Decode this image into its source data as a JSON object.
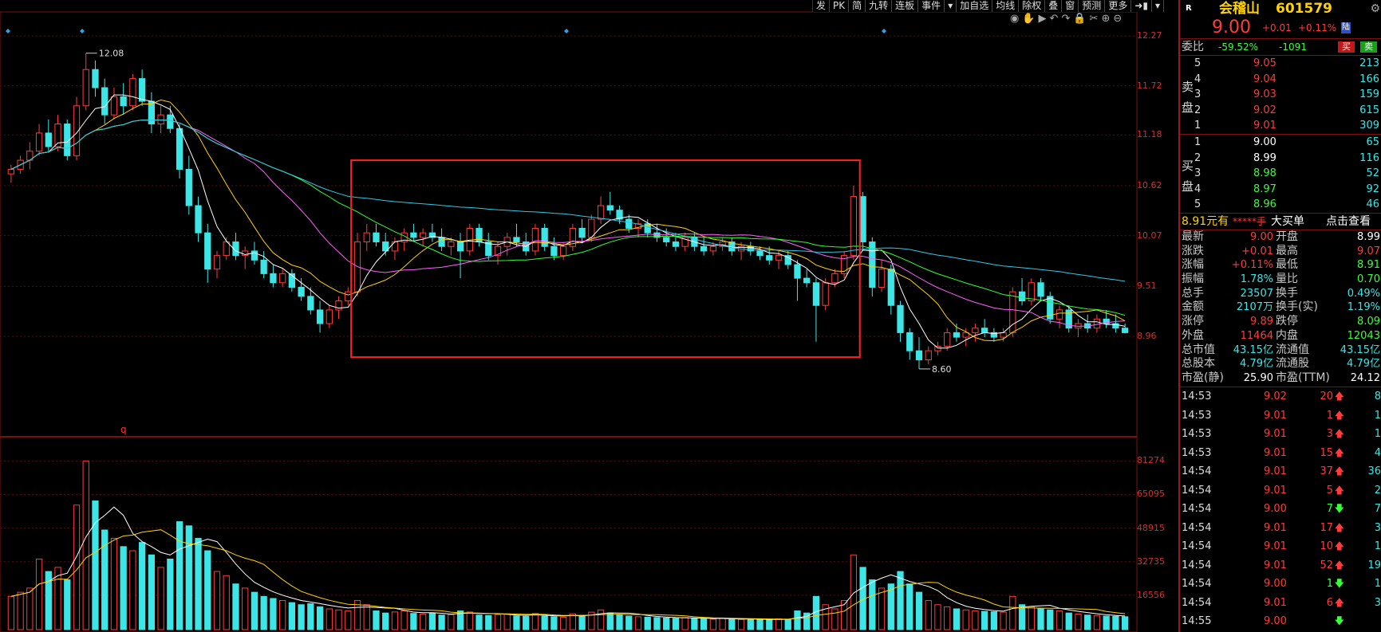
{
  "toolbar": [
    "发",
    "PK",
    "简",
    "九转",
    "连板",
    "事件",
    "▾",
    "加自选",
    "均线",
    "除权",
    "叠",
    "窗",
    "预测",
    "更多",
    "➜▮",
    "▾"
  ],
  "icons": [
    {
      "name": "eye-icon",
      "glyph": "◉"
    },
    {
      "name": "hand-icon",
      "glyph": "✋"
    },
    {
      "name": "play-icon",
      "glyph": "▶"
    },
    {
      "name": "undo-icon",
      "glyph": "↶"
    },
    {
      "name": "redo-icon",
      "glyph": "↷"
    },
    {
      "name": "lock-icon",
      "glyph": "🔒"
    },
    {
      "name": "scissors-icon",
      "glyph": "✂"
    },
    {
      "name": "zoom-in-icon",
      "glyph": "⊕"
    },
    {
      "name": "zoom-out-icon",
      "glyph": "⊖"
    }
  ],
  "price_axis": [
    "12.27",
    "11.72",
    "11.18",
    "10.62",
    "10.07",
    "9.51",
    "8.96"
  ],
  "volume_axis": [
    "81274",
    "65095",
    "48915",
    "32735",
    "16556"
  ],
  "annotations": {
    "high": "12.08",
    "low": "8.60",
    "marker": "q"
  },
  "colors": {
    "up": "#ff3b3b",
    "down": "#3ce6e6",
    "ma5": "#ffffff",
    "ma10": "#ffd200",
    "ma20": "#ff60ff",
    "ma30": "#30ff30",
    "ma60": "#30c8e8",
    "highlight": "#ff2020"
  },
  "chart_data": {
    "type": "candlestick",
    "ylim": [
      8.45,
      12.35
    ],
    "candles": [
      [
        10.75,
        10.85,
        10.65,
        10.8
      ],
      [
        10.8,
        10.95,
        10.75,
        10.9
      ],
      [
        10.9,
        11.1,
        10.8,
        11.0
      ],
      [
        11.0,
        11.3,
        10.95,
        11.2
      ],
      [
        11.2,
        11.35,
        11.0,
        11.05
      ],
      [
        11.05,
        11.4,
        11.0,
        11.3
      ],
      [
        11.3,
        11.35,
        10.9,
        10.95
      ],
      [
        10.95,
        11.6,
        10.9,
        11.5
      ],
      [
        11.5,
        12.08,
        11.45,
        11.9
      ],
      [
        11.9,
        12.0,
        11.6,
        11.7
      ],
      [
        11.7,
        11.8,
        11.3,
        11.4
      ],
      [
        11.4,
        11.7,
        11.35,
        11.6
      ],
      [
        11.6,
        11.75,
        11.4,
        11.5
      ],
      [
        11.5,
        11.85,
        11.45,
        11.8
      ],
      [
        11.8,
        11.9,
        11.5,
        11.55
      ],
      [
        11.55,
        11.65,
        11.2,
        11.3
      ],
      [
        11.3,
        11.5,
        11.2,
        11.4
      ],
      [
        11.4,
        11.5,
        11.2,
        11.25
      ],
      [
        11.25,
        11.3,
        10.7,
        10.8
      ],
      [
        10.8,
        10.95,
        10.3,
        10.4
      ],
      [
        10.4,
        10.5,
        10.0,
        10.1
      ],
      [
        10.1,
        10.2,
        9.55,
        9.7
      ],
      [
        9.7,
        9.9,
        9.6,
        9.85
      ],
      [
        9.85,
        10.05,
        9.8,
        10.0
      ],
      [
        10.0,
        10.1,
        9.8,
        9.85
      ],
      [
        9.85,
        9.95,
        9.7,
        9.9
      ],
      [
        9.9,
        10.0,
        9.75,
        9.8
      ],
      [
        9.8,
        9.9,
        9.6,
        9.65
      ],
      [
        9.65,
        9.75,
        9.5,
        9.55
      ],
      [
        9.55,
        9.7,
        9.5,
        9.65
      ],
      [
        9.65,
        9.7,
        9.45,
        9.5
      ],
      [
        9.5,
        9.6,
        9.35,
        9.4
      ],
      [
        9.4,
        9.5,
        9.2,
        9.25
      ],
      [
        9.25,
        9.35,
        9.0,
        9.1
      ],
      [
        9.1,
        9.3,
        9.05,
        9.25
      ],
      [
        9.25,
        9.4,
        9.15,
        9.35
      ],
      [
        9.35,
        9.5,
        9.3,
        9.45
      ],
      [
        9.45,
        10.1,
        9.4,
        10.0
      ],
      [
        10.0,
        10.2,
        9.9,
        10.1
      ],
      [
        10.1,
        10.2,
        9.95,
        10.0
      ],
      [
        10.0,
        10.1,
        9.85,
        9.9
      ],
      [
        9.9,
        10.05,
        9.8,
        10.0
      ],
      [
        10.0,
        10.15,
        9.9,
        10.1
      ],
      [
        10.1,
        10.2,
        10.0,
        10.05
      ],
      [
        10.05,
        10.15,
        9.95,
        10.1
      ],
      [
        10.1,
        10.2,
        10.0,
        10.05
      ],
      [
        10.05,
        10.15,
        9.9,
        9.95
      ],
      [
        9.95,
        10.05,
        9.85,
        10.0
      ],
      [
        10.0,
        10.1,
        9.6,
        9.9
      ],
      [
        9.9,
        10.2,
        9.85,
        10.15
      ],
      [
        10.15,
        10.2,
        9.95,
        10.0
      ],
      [
        10.0,
        10.1,
        9.8,
        9.85
      ],
      [
        9.85,
        10.0,
        9.75,
        9.95
      ],
      [
        9.95,
        10.1,
        9.85,
        10.05
      ],
      [
        10.05,
        10.2,
        9.95,
        10.0
      ],
      [
        10.0,
        10.1,
        9.85,
        9.9
      ],
      [
        9.9,
        10.2,
        9.85,
        10.15
      ],
      [
        10.15,
        10.2,
        9.9,
        9.95
      ],
      [
        9.95,
        10.05,
        9.8,
        9.85
      ],
      [
        9.85,
        10.0,
        9.8,
        9.95
      ],
      [
        9.95,
        10.2,
        9.9,
        10.15
      ],
      [
        10.15,
        10.25,
        10.0,
        10.05
      ],
      [
        10.05,
        10.3,
        10.0,
        10.25
      ],
      [
        10.25,
        10.5,
        10.2,
        10.4
      ],
      [
        10.4,
        10.55,
        10.3,
        10.35
      ],
      [
        10.35,
        10.4,
        10.2,
        10.25
      ],
      [
        10.25,
        10.3,
        10.1,
        10.15
      ],
      [
        10.15,
        10.25,
        10.05,
        10.2
      ],
      [
        10.2,
        10.25,
        10.05,
        10.1
      ],
      [
        10.1,
        10.2,
        10.0,
        10.05
      ],
      [
        10.05,
        10.15,
        9.95,
        10.0
      ],
      [
        10.0,
        10.1,
        9.9,
        9.95
      ],
      [
        9.95,
        10.1,
        9.9,
        10.05
      ],
      [
        10.05,
        10.1,
        9.9,
        9.95
      ],
      [
        9.95,
        10.05,
        9.85,
        9.9
      ],
      [
        9.9,
        10.0,
        9.85,
        9.95
      ],
      [
        9.95,
        10.05,
        9.9,
        10.0
      ],
      [
        10.0,
        10.05,
        9.85,
        9.9
      ],
      [
        9.9,
        10.0,
        9.8,
        9.95
      ],
      [
        9.95,
        10.0,
        9.85,
        9.9
      ],
      [
        9.9,
        9.95,
        9.8,
        9.85
      ],
      [
        9.85,
        9.95,
        9.75,
        9.8
      ],
      [
        9.8,
        9.9,
        9.7,
        9.85
      ],
      [
        9.85,
        9.9,
        9.7,
        9.75
      ],
      [
        9.75,
        9.8,
        9.35,
        9.6
      ],
      [
        9.6,
        9.7,
        9.5,
        9.55
      ],
      [
        9.55,
        9.6,
        8.9,
        9.3
      ],
      [
        9.3,
        9.6,
        9.25,
        9.55
      ],
      [
        9.55,
        9.7,
        9.5,
        9.65
      ],
      [
        9.65,
        9.9,
        9.6,
        9.85
      ],
      [
        9.85,
        10.62,
        9.8,
        10.5
      ],
      [
        10.5,
        10.55,
        9.9,
        10.0
      ],
      [
        10.0,
        10.05,
        9.4,
        9.5
      ],
      [
        9.5,
        9.8,
        9.45,
        9.7
      ],
      [
        9.7,
        9.75,
        9.2,
        9.3
      ],
      [
        9.3,
        9.35,
        8.9,
        9.0
      ],
      [
        9.0,
        9.05,
        8.7,
        8.8
      ],
      [
        8.8,
        8.95,
        8.6,
        8.7
      ],
      [
        8.7,
        8.85,
        8.65,
        8.8
      ],
      [
        8.8,
        8.9,
        8.75,
        8.85
      ],
      [
        8.85,
        9.05,
        8.8,
        9.0
      ],
      [
        9.0,
        9.1,
        8.9,
        8.95
      ],
      [
        8.95,
        9.05,
        8.85,
        9.0
      ],
      [
        9.0,
        9.1,
        8.9,
        9.05
      ],
      [
        9.05,
        9.15,
        8.95,
        9.0
      ],
      [
        9.0,
        9.05,
        8.9,
        8.95
      ],
      [
        8.95,
        9.05,
        8.9,
        9.0
      ],
      [
        9.0,
        9.5,
        8.95,
        9.45
      ],
      [
        9.45,
        9.6,
        9.3,
        9.35
      ],
      [
        9.35,
        9.6,
        9.3,
        9.55
      ],
      [
        9.55,
        9.6,
        9.35,
        9.4
      ],
      [
        9.4,
        9.45,
        9.1,
        9.15
      ],
      [
        9.15,
        9.3,
        9.05,
        9.25
      ],
      [
        9.25,
        9.3,
        9.0,
        9.05
      ],
      [
        9.05,
        9.15,
        8.95,
        9.1
      ],
      [
        9.1,
        9.2,
        9.0,
        9.05
      ],
      [
        9.05,
        9.2,
        9.0,
        9.15
      ],
      [
        9.15,
        9.25,
        9.05,
        9.1
      ],
      [
        9.1,
        9.2,
        9.0,
        9.05
      ],
      [
        9.05,
        9.1,
        8.99,
        9.0
      ]
    ],
    "volumes": [
      16000,
      18000,
      20000,
      34000,
      28000,
      30000,
      24000,
      60000,
      81274,
      62000,
      48000,
      44000,
      40000,
      38000,
      42000,
      36000,
      30000,
      34000,
      52000,
      50000,
      44000,
      38000,
      28000,
      26000,
      22000,
      20000,
      18000,
      16000,
      15000,
      14000,
      13000,
      12000,
      12500,
      11000,
      10000,
      9500,
      9000,
      14000,
      12000,
      9000,
      8000,
      8500,
      9000,
      7800,
      7500,
      8000,
      7000,
      7200,
      9000,
      8500,
      7000,
      6800,
      7200,
      7500,
      6600,
      6400,
      7800,
      6500,
      6200,
      6000,
      7600,
      6800,
      8400,
      9500,
      8000,
      7200,
      6500,
      6200,
      6000,
      5800,
      5600,
      5400,
      5800,
      5500,
      5200,
      5000,
      5400,
      5100,
      4900,
      5000,
      4800,
      4700,
      5200,
      5000,
      9000,
      8000,
      16000,
      12000,
      10000,
      14000,
      36000,
      30000,
      24000,
      20000,
      22000,
      28000,
      22000,
      18000,
      14000,
      12000,
      11000,
      10000,
      9500,
      9000,
      8800,
      8600,
      8400,
      16000,
      12000,
      11000,
      10000,
      9500,
      9000,
      8000,
      7500,
      7000,
      6800,
      6500,
      6400,
      6200
    ],
    "ma_series": [
      {
        "name": "MA5",
        "color": "#ffffff",
        "period": 5
      },
      {
        "name": "MA10",
        "color": "#ffd200",
        "period": 10
      },
      {
        "name": "MA20",
        "color": "#ff60ff",
        "period": 20
      },
      {
        "name": "MA30",
        "color": "#30ff30",
        "period": 30
      },
      {
        "name": "MA60",
        "color": "#30c8e8",
        "period": 60
      }
    ],
    "highlight_box": {
      "from_index": 37,
      "to_index": 90,
      "price_top": 10.9,
      "price_bottom": 8.73
    }
  },
  "quote": {
    "badge": "R",
    "name": "会稽山",
    "code": "601579",
    "price": "9.00",
    "change": "+0.01",
    "pct": "+0.11%",
    "tag": "陆",
    "weibi_label": "委比",
    "weibi_pct": "-59.52%",
    "weibi_diff": "-1091",
    "buy_btn": "买",
    "sell_btn": "卖",
    "sell_side_label": [
      "卖",
      "盘"
    ],
    "buy_side_label": [
      "买",
      "盘"
    ],
    "asks": [
      {
        "lvl": "5",
        "price": "9.05",
        "vol": "213"
      },
      {
        "lvl": "4",
        "price": "9.04",
        "vol": "166"
      },
      {
        "lvl": "3",
        "price": "9.03",
        "vol": "159"
      },
      {
        "lvl": "2",
        "price": "9.02",
        "vol": "615"
      },
      {
        "lvl": "1",
        "price": "9.01",
        "vol": "309"
      }
    ],
    "bids": [
      {
        "lvl": "1",
        "price": "9.00",
        "vol": "65",
        "cls": "white"
      },
      {
        "lvl": "2",
        "price": "8.99",
        "vol": "116",
        "cls": "white"
      },
      {
        "lvl": "3",
        "price": "8.98",
        "vol": "52",
        "cls": "green"
      },
      {
        "lvl": "4",
        "price": "8.97",
        "vol": "92",
        "cls": "green"
      },
      {
        "lvl": "5",
        "price": "8.96",
        "vol": "46",
        "cls": "green"
      }
    ],
    "big_order": {
      "price": "8.91元有",
      "stars": "*****手",
      "label": "大买单",
      "link": "点击查看"
    },
    "stats": [
      [
        "最新",
        "9.00",
        "red",
        "开盘",
        "8.99",
        "white"
      ],
      [
        "涨跌",
        "+0.01",
        "red",
        "最高",
        "9.07",
        "red"
      ],
      [
        "涨幅",
        "+0.11%",
        "red",
        "最低",
        "8.91",
        "green"
      ],
      [
        "振幅",
        "1.78%",
        "cyan",
        "量比",
        "0.70",
        "green"
      ],
      [
        "总手",
        "23507",
        "cyan",
        "换手",
        "0.49%",
        "cyan"
      ],
      [
        "金额",
        "2107万",
        "cyan",
        "换手(实)",
        "1.19%",
        "cyan"
      ],
      [
        "涨停",
        "9.89",
        "red",
        "跌停",
        "8.09",
        "green"
      ],
      [
        "外盘",
        "11464",
        "red",
        "内盘",
        "12043",
        "green"
      ],
      [
        "总市值",
        "43.15亿",
        "cyan",
        "流通值",
        "43.15亿",
        "cyan"
      ],
      [
        "总股本",
        "4.79亿",
        "cyan",
        "流通股",
        "4.79亿",
        "cyan"
      ],
      [
        "市盈(静)",
        "25.90",
        "white",
        "市盈(TTM)",
        "24.12",
        "white"
      ]
    ],
    "ticks": [
      [
        "14:53",
        "9.02",
        "red",
        "20",
        "up",
        "8"
      ],
      [
        "14:53",
        "9.01",
        "red",
        "1",
        "up",
        "1"
      ],
      [
        "14:53",
        "9.01",
        "red",
        "3",
        "up",
        "1"
      ],
      [
        "14:53",
        "9.01",
        "red",
        "15",
        "up",
        "4"
      ],
      [
        "14:54",
        "9.01",
        "red",
        "37",
        "up",
        "36"
      ],
      [
        "14:54",
        "9.01",
        "red",
        "5",
        "up",
        "2"
      ],
      [
        "14:54",
        "9.00",
        "red",
        "7",
        "down",
        "7"
      ],
      [
        "14:54",
        "9.01",
        "red",
        "17",
        "up",
        "3"
      ],
      [
        "14:54",
        "9.01",
        "red",
        "10",
        "up",
        "1"
      ],
      [
        "14:54",
        "9.01",
        "red",
        "52",
        "up",
        "19"
      ],
      [
        "14:54",
        "9.00",
        "red",
        "1",
        "down",
        "1"
      ],
      [
        "14:54",
        "9.01",
        "red",
        "6",
        "up",
        "3"
      ],
      [
        "14:55",
        "9.00",
        "red",
        "",
        "down",
        ""
      ]
    ]
  }
}
